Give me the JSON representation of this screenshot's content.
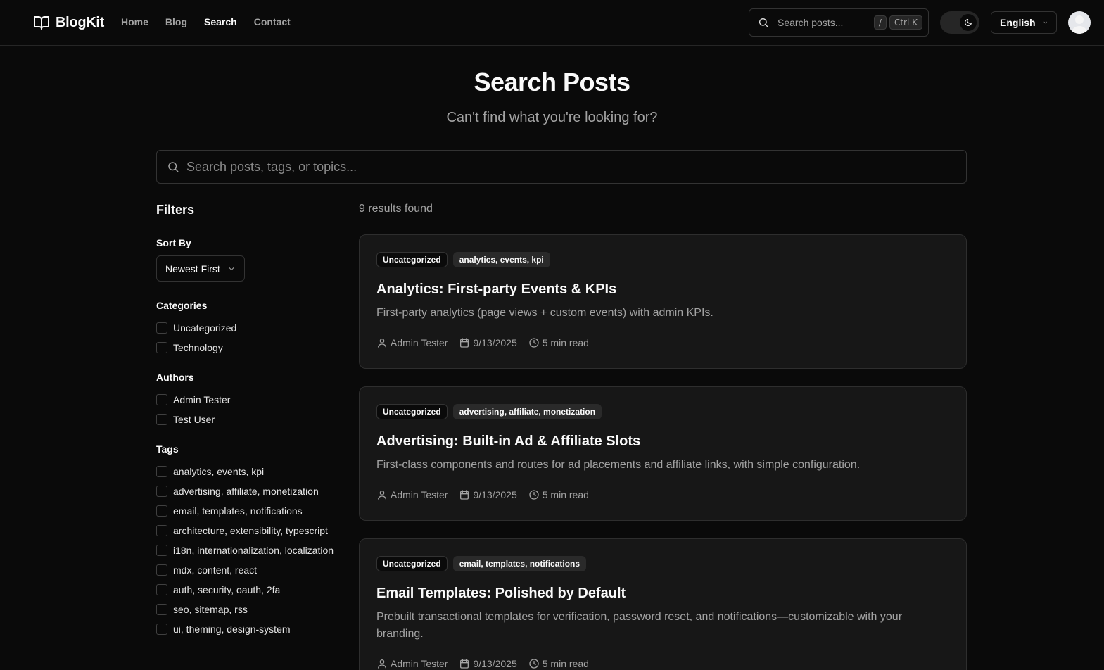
{
  "header": {
    "brand": "BlogKit",
    "nav": [
      {
        "label": "Home",
        "active": false
      },
      {
        "label": "Blog",
        "active": false
      },
      {
        "label": "Search",
        "active": true
      },
      {
        "label": "Contact",
        "active": false
      }
    ],
    "search_placeholder": "Search posts...",
    "shortcut_slash": "/",
    "shortcut_ctrlk": "Ctrl K",
    "language": "English"
  },
  "hero": {
    "title": "Search Posts",
    "subtitle": "Can't find what you're looking for?",
    "search_placeholder": "Search posts, tags, or topics..."
  },
  "filters": {
    "title": "Filters",
    "sort_label": "Sort By",
    "sort_value": "Newest First",
    "categories_label": "Categories",
    "categories": [
      "Uncategorized",
      "Technology"
    ],
    "authors_label": "Authors",
    "authors": [
      "Admin Tester",
      "Test User"
    ],
    "tags_label": "Tags",
    "tags": [
      "analytics, events, kpi",
      "advertising, affiliate, monetization",
      "email, templates, notifications",
      "architecture, extensibility, typescript",
      "i18n, internationalization, localization",
      "mdx, content, react",
      "auth, security, oauth, 2fa",
      "seo, sitemap, rss",
      "ui, theming, design-system"
    ]
  },
  "results": {
    "count_text": "9 results found",
    "posts": [
      {
        "category": "Uncategorized",
        "tags": "analytics, events, kpi",
        "title": "Analytics: First-party Events & KPIs",
        "excerpt": "First-party analytics (page views + custom events) with admin KPIs.",
        "author": "Admin Tester",
        "date": "9/13/2025",
        "read_time": "5 min read"
      },
      {
        "category": "Uncategorized",
        "tags": "advertising, affiliate, monetization",
        "title": "Advertising: Built-in Ad & Affiliate Slots",
        "excerpt": "First-class components and routes for ad placements and affiliate links, with simple configuration.",
        "author": "Admin Tester",
        "date": "9/13/2025",
        "read_time": "5 min read"
      },
      {
        "category": "Uncategorized",
        "tags": "email, templates, notifications",
        "title": "Email Templates: Polished by Default",
        "excerpt": "Prebuilt transactional templates for verification, password reset, and notifications—customizable with your branding.",
        "author": "Admin Tester",
        "date": "9/13/2025",
        "read_time": "5 min read"
      }
    ]
  }
}
